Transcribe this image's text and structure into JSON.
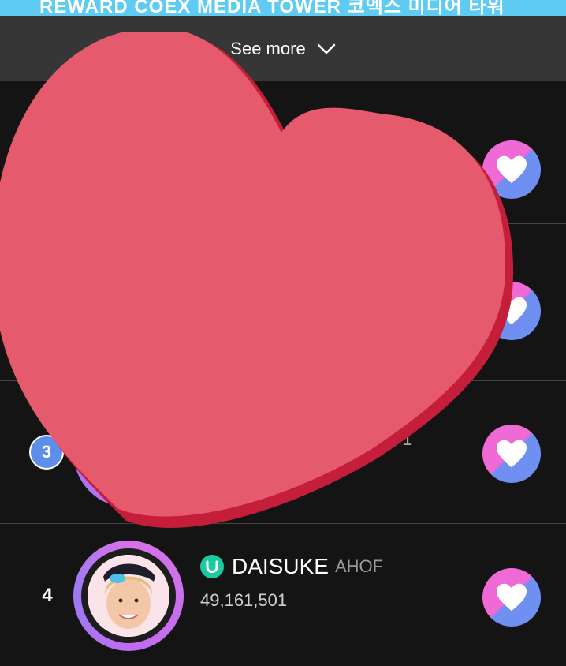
{
  "banner": {
    "text": "REWARD  COEX MEDIA TOWER 코엑스 미디어 타워"
  },
  "see_more": {
    "label": "See more",
    "icon": "chevron-down-icon"
  },
  "rows": [
    {
      "rank": "",
      "icon": "heart-icon"
    },
    {
      "rank": "",
      "icon": "heart-icon"
    },
    {
      "rank": "3",
      "votes_partial": "1",
      "icon": "heart-icon"
    },
    {
      "rank": "4",
      "name": "DAISUKE",
      "group": "AHOF",
      "votes": "49,161,501",
      "icon": "heart-icon"
    }
  ],
  "colors": {
    "background": "#141414",
    "see_more_bg": "#363636",
    "accent_pink": "#f06ad6",
    "accent_blue": "#6f8ff1",
    "verify_green": "#1cc9a2",
    "overlay_heart": "#e65a6e"
  }
}
